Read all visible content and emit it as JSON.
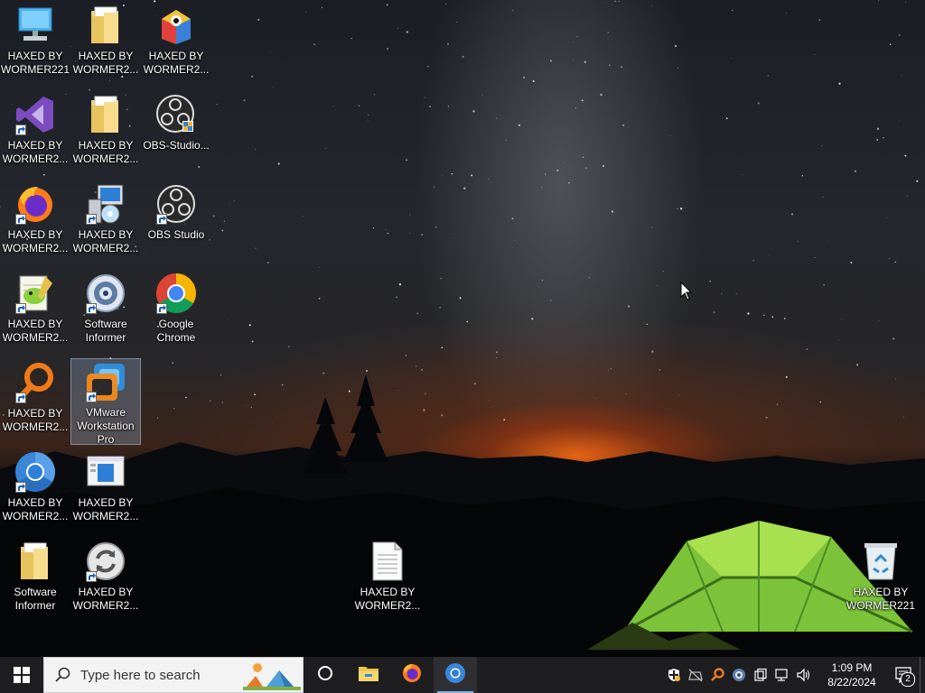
{
  "desktop_icons": [
    {
      "label": "HAXED BY WORMER221",
      "icon": "computer-icon",
      "shortcut": false
    },
    {
      "label": "HAXED BY WORMER2...",
      "icon": "folder-icon",
      "shortcut": false
    },
    {
      "label": "HAXED BY WORMER2...",
      "icon": "bluestacks-icon",
      "shortcut": false
    },
    {
      "label": "HAXED BY WORMER2...",
      "icon": "visual-studio-icon",
      "shortcut": true
    },
    {
      "label": "HAXED BY WORMER2...",
      "icon": "folder-icon",
      "shortcut": false
    },
    {
      "label": "OBS-Studio...",
      "icon": "obs-installer-icon",
      "shortcut": false
    },
    {
      "label": "HAXED BY WORMER2...",
      "icon": "firefox-icon",
      "shortcut": true
    },
    {
      "label": "HAXED BY WORMER2...",
      "icon": "installer-icon",
      "shortcut": true
    },
    {
      "label": "OBS Studio",
      "icon": "obs-icon",
      "shortcut": true
    },
    {
      "label": "HAXED BY WORMER2...",
      "icon": "notepad-plus-plus-icon",
      "shortcut": true
    },
    {
      "label": "Software Informer",
      "icon": "software-informer-icon",
      "shortcut": true
    },
    {
      "label": "Google Chrome",
      "icon": "chrome-icon",
      "shortcut": true
    },
    {
      "label": "HAXED BY WORMER2...",
      "icon": "search-tool-icon",
      "shortcut": true
    },
    {
      "label": "VMware Workstation Pro",
      "icon": "vmware-icon",
      "shortcut": true,
      "selected": true
    },
    {
      "label": "HAXED BY WORMER2...",
      "icon": "chromium-icon",
      "shortcut": true
    },
    {
      "label": "HAXED BY WORMER2...",
      "icon": "window-app-icon",
      "shortcut": false
    },
    {
      "label": "Software Informer",
      "icon": "folder-icon",
      "shortcut": false
    },
    {
      "label": "HAXED BY WORMER2...",
      "icon": "sync-icon",
      "shortcut": true
    },
    {
      "label": "HAXED BY WORMER2...",
      "icon": "text-document-icon",
      "shortcut": false
    },
    {
      "label": "HAXED BY WORMER221",
      "icon": "recycle-bin-icon",
      "shortcut": false
    }
  ],
  "taskbar": {
    "search_placeholder": "Type here to search",
    "pinned": [
      {
        "name": "cortana-icon"
      },
      {
        "name": "file-explorer-icon"
      },
      {
        "name": "firefox-icon"
      },
      {
        "name": "chromium-icon",
        "active": true
      }
    ],
    "tray": [
      "security-shield-icon",
      "network-disconnected-icon",
      "search-tool-icon",
      "software-informer-icon",
      "task-view-icon",
      "network-icon",
      "volume-icon"
    ],
    "clock_time": "1:09 PM",
    "clock_date": "8/22/2024",
    "notification_count": "2"
  }
}
